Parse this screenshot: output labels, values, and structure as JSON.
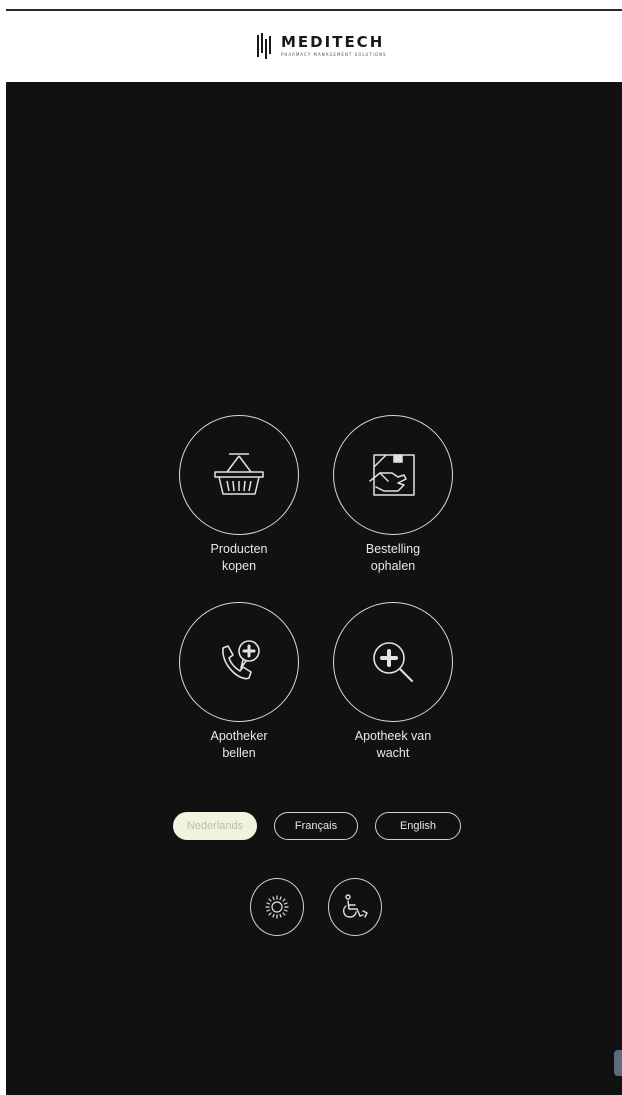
{
  "header": {
    "brand_name": "MEDITECH",
    "brand_tagline": "PHARMACY MANAGEMENT SOLUTIONS"
  },
  "tiles": [
    {
      "line1": "Producten",
      "line2": "kopen",
      "icon": "basket-icon"
    },
    {
      "line1": "Bestelling",
      "line2": "ophalen",
      "icon": "package-hand-icon"
    },
    {
      "line1": "Apotheker",
      "line2": "bellen",
      "icon": "phone-plus-icon"
    },
    {
      "line1": "Apotheek van",
      "line2": "wacht",
      "icon": "magnifier-plus-icon"
    }
  ],
  "languages": [
    {
      "label": "Nederlands",
      "selected": true
    },
    {
      "label": "Français",
      "selected": false
    },
    {
      "label": "English",
      "selected": false
    }
  ],
  "accessibility": {
    "brightness_icon": "sun-icon",
    "wheelchair_icon": "wheelchair-icon"
  },
  "colors": {
    "background": "#111111",
    "header": "#ffffff",
    "outline": "#d8d8d8",
    "active_language": "#eef4dd"
  }
}
